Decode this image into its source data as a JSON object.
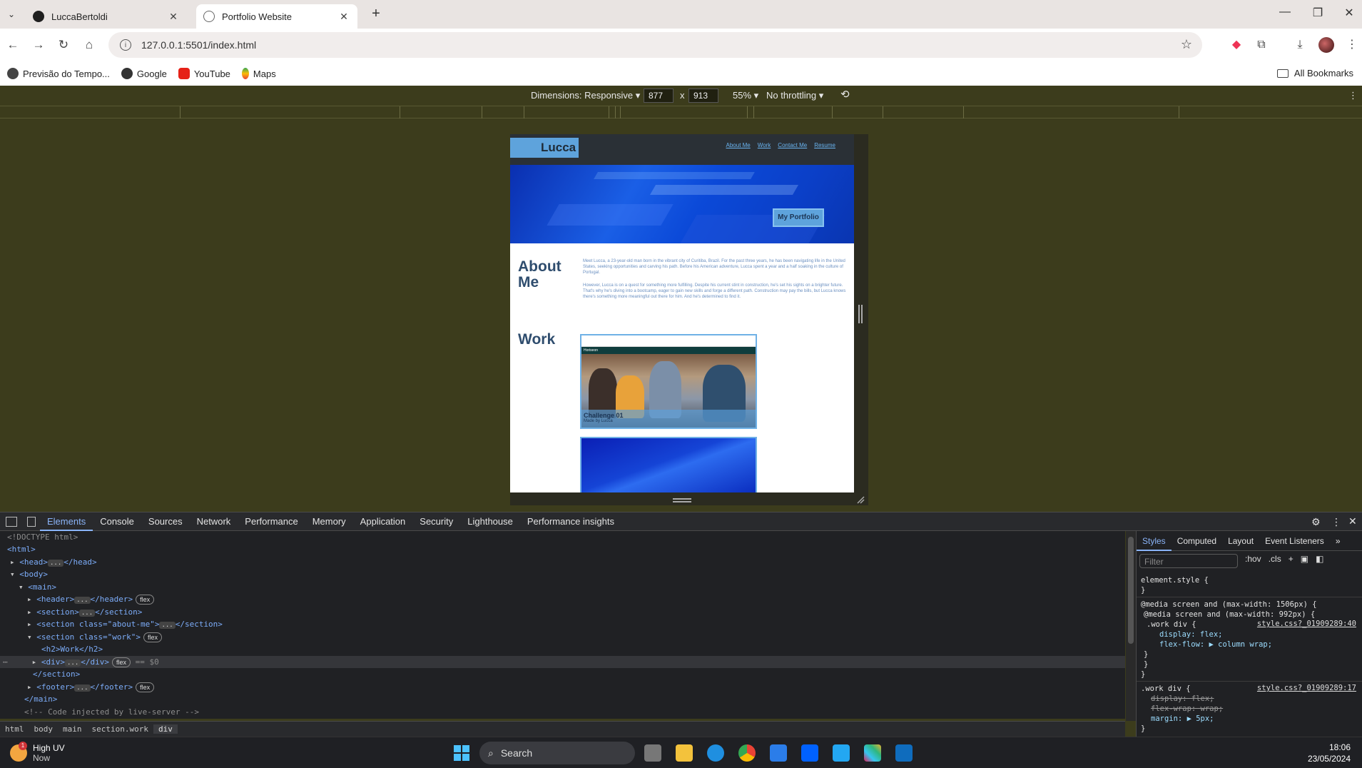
{
  "browser": {
    "tabs": [
      {
        "title": "LuccaBertoldi",
        "active": false,
        "favicon": "github-icon"
      },
      {
        "title": "Portfolio Website",
        "active": true,
        "favicon": "globe-icon"
      }
    ],
    "url": "127.0.0.1:5501/index.html",
    "bookmarks": [
      "Previsão do Tempo...",
      "Google",
      "YouTube",
      "Maps"
    ],
    "all_bookmarks": "All Bookmarks"
  },
  "device_toolbar": {
    "dimensions_label": "Dimensions: Responsive",
    "width": "877",
    "height": "913",
    "x": "x",
    "zoom": "55%",
    "throttling": "No throttling"
  },
  "site": {
    "logo": "Lucca",
    "nav": [
      "About Me",
      "Work",
      "Contact Me",
      "Resume"
    ],
    "hero_button": "My Portfolio",
    "about_title": "About Me",
    "about_paragraphs": [
      "Meet Lucca, a 23-year-old man born in the vibrant city of Curitiba, Brazil. For the past three years, he has been navigating life in the United States, seeking opportunities and carving his path. Before his American adventure, Lucca spent a year and a half soaking in the culture of Portugal.",
      "However, Lucca is on a quest for something more fulfilling. Despite his current stint in construction, he's set his sights on a brighter future. That's why he's diving into a bootcamp, eager to gain new skills and forge a different path. Construction may pay the bills, but Lucca knows there's something more meaningful out there for him. And he's determined to find it."
    ],
    "work_title": "Work",
    "card": {
      "site_name": "Horiseon",
      "title": "Challenge 01",
      "subtitle": "Made by Lucca"
    }
  },
  "devtools": {
    "tabs": [
      "Elements",
      "Console",
      "Sources",
      "Network",
      "Performance",
      "Memory",
      "Application",
      "Security",
      "Lighthouse",
      "Performance insights"
    ],
    "active_tab": "Elements",
    "elements_lines": [
      "<!DOCTYPE html>",
      "<html>",
      "<head>",
      "</head>",
      "<body>",
      "<main>",
      "<header>",
      "</header>",
      "<section>",
      "</section>",
      "<section class=\"about-me\">",
      "<section class=\"work\">",
      "<h2>Work</h2>",
      "<div>",
      "</div>",
      "== $0",
      "</section>",
      "<footer>",
      "</footer>",
      "</main>",
      "<!-- Code injected by live-server -->",
      "flex",
      "..."
    ],
    "breadcrumbs": [
      "html",
      "body",
      "main",
      "section.work",
      "div"
    ],
    "styles_tabs": [
      "Styles",
      "Computed",
      "Layout",
      "Event Listeners"
    ],
    "filter_placeholder": "Filter",
    "style_tools": [
      ":hov",
      ".cls",
      "+"
    ],
    "css": {
      "element_style": "element.style {",
      "media1": "@media screen and (max-width: 1506px) {",
      "media2": "@media screen and (max-width: 992px) {",
      "rule1_selector": ".work div {",
      "rule1_source": "style.css?_01909289:40",
      "rule1_props": [
        "display: flex;",
        "flex-flow: ▶ column wrap;"
      ],
      "rule2_selector": ".work div {",
      "rule2_source": "style.css?_01909289:17",
      "rule2_props": [
        "display: flex;",
        "flex-wrap: wrap;",
        "margin: ▶ 5px;"
      ],
      "brace_close": "}",
      "brace_close_tab": "  }"
    }
  },
  "taskbar": {
    "weather_title": "High UV",
    "weather_sub": "Now",
    "notification_count": "1",
    "search": "Search",
    "time": "18:06",
    "date": "23/05/2024"
  }
}
